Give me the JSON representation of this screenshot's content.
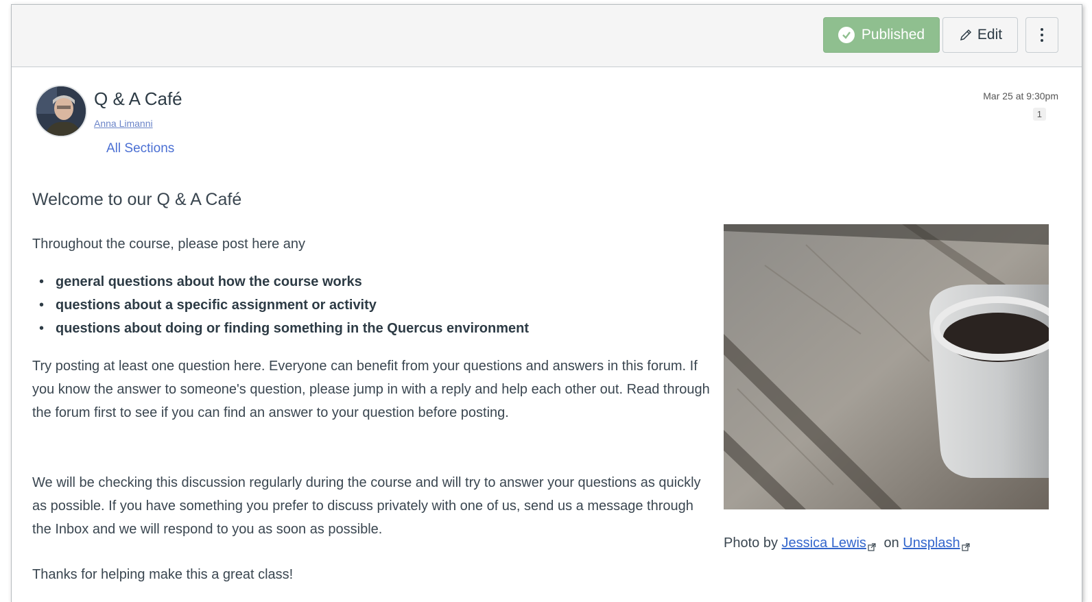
{
  "toolbar": {
    "published_label": "Published",
    "edit_label": "Edit",
    "colors": {
      "published_bg": "#8fbf8f",
      "toolbar_bg": "#f5f5f5"
    }
  },
  "post": {
    "title": "Q & A Café",
    "author": "Anna Limanni",
    "sections": "All Sections",
    "date": "Mar 25 at 9:30pm",
    "badge_count": "1"
  },
  "content": {
    "heading": "Welcome to our Q & A Café",
    "intro": "Throughout the course, please post here any",
    "bullets": [
      "general questions about how the course works",
      "questions about a specific assignment or activity",
      "questions about doing or finding something in the Quercus environment"
    ],
    "paragraph1": "Try posting at least one question here.  Everyone can benefit from your questions and answers in this forum. If you know the answer to someone's question, please jump in with a reply and help each other out. Read through the forum first to see if you can find an answer to your question before posting.",
    "paragraph2": "We will be checking this discussion regularly during the course and will try to answer your questions as quickly as possible. If you have something you prefer to discuss privately with one of us, send us a message through the Inbox and we will respond to you as soon as possible.",
    "paragraph3": "Thanks for helping make this a great class!"
  },
  "photo": {
    "caption_prefix": "Photo by",
    "photographer": "Jessica Lewis",
    "caption_mid": "on",
    "site": "Unsplash"
  }
}
